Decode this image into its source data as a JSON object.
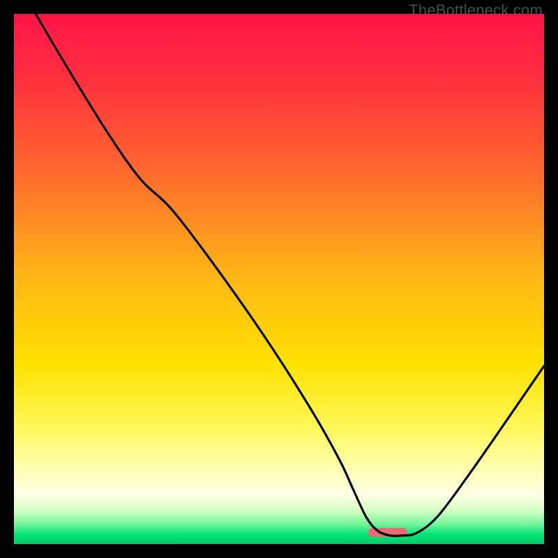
{
  "watermark": "TheBottleneck.com",
  "chart_data": {
    "type": "line",
    "title": "",
    "xlabel": "",
    "ylabel": "",
    "xlim": [
      0,
      100
    ],
    "ylim": [
      0,
      100
    ],
    "gradient_stops": [
      {
        "offset": 0.0,
        "color": "#ff1447"
      },
      {
        "offset": 0.12,
        "color": "#ff2f3f"
      },
      {
        "offset": 0.3,
        "color": "#ff6a2e"
      },
      {
        "offset": 0.5,
        "color": "#ffb815"
      },
      {
        "offset": 0.66,
        "color": "#ffe100"
      },
      {
        "offset": 0.78,
        "color": "#fff85a"
      },
      {
        "offset": 0.855,
        "color": "#ffffaf"
      },
      {
        "offset": 0.905,
        "color": "#ffffe6"
      },
      {
        "offset": 0.935,
        "color": "#d9ffc6"
      },
      {
        "offset": 0.962,
        "color": "#76f59a"
      },
      {
        "offset": 0.982,
        "color": "#00e477"
      },
      {
        "offset": 1.0,
        "color": "#00c86a"
      }
    ],
    "series": [
      {
        "name": "bottleneck-curve",
        "x": [
          4.1,
          10.3,
          17.8,
          23.9,
          29.7,
          37.6,
          47.5,
          56.1,
          61.4,
          64.0,
          66.5,
          68.6,
          71.0,
          73.0,
          76.0,
          80.0,
          85.9,
          92.1,
          100.0
        ],
        "y": [
          100.0,
          89.5,
          77.4,
          68.8,
          63.2,
          52.9,
          38.8,
          25.3,
          15.9,
          10.3,
          5.0,
          2.5,
          1.6,
          1.6,
          2.1,
          5.3,
          13.2,
          22.1,
          33.6
        ]
      }
    ],
    "marker": {
      "x": 70.5,
      "y": 2.2,
      "width": 7.4,
      "height": 1.7,
      "color": "#e96a72"
    }
  }
}
